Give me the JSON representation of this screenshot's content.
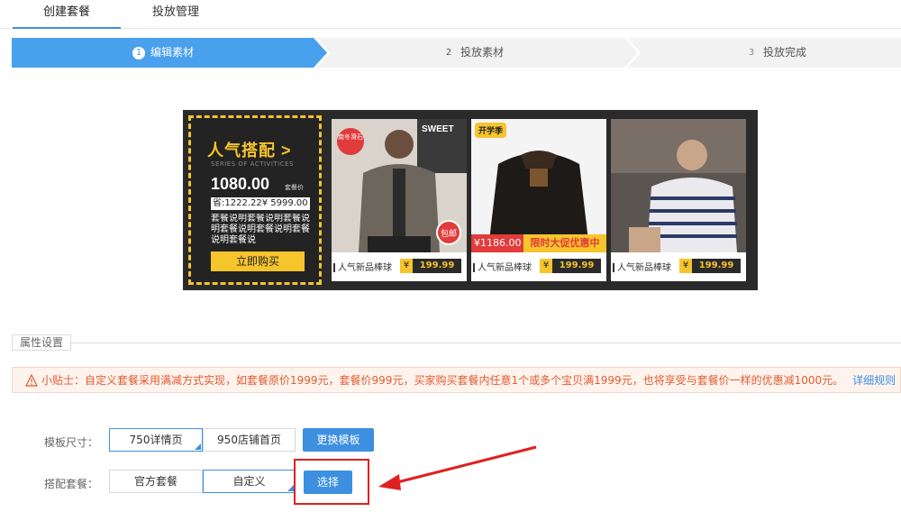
{
  "tabs": [
    {
      "label": "创建套餐",
      "active": true
    },
    {
      "label": "投放管理",
      "active": false
    }
  ],
  "steps": [
    {
      "num": "1",
      "label": "编辑素材",
      "active": true
    },
    {
      "num": "2",
      "label": "投放素材",
      "active": false
    },
    {
      "num": "3",
      "label": "投放完成",
      "active": false
    }
  ],
  "colors": {
    "accent": "#3d8fe0",
    "step_active": "#49a0ec",
    "yellow": "#f6c42b",
    "red": "#e02020"
  },
  "banner": {
    "title": "人气搭配",
    "title_arrow": ">",
    "subtitle": "SERIES OF ACTIVITICES",
    "price": "1080.00",
    "price_unit": "套餐价",
    "orig": "省:1222.22¥ 5999.00",
    "desc": "套餐说明套餐说明套餐说明套餐说明套餐说明套餐说明套餐说",
    "buy_label": "立即购买",
    "products": [
      {
        "caption": "人气新品棒球",
        "yen": "¥",
        "price": "199.99",
        "badge_top": "南冬滑石",
        "badge_bottom": "包邮"
      },
      {
        "caption": "人气新品棒球",
        "yen": "¥",
        "price": "199.99",
        "badge_tag": "开学季",
        "price_tag": "¥1186.00",
        "promo_tag": "限时大促优惠中"
      },
      {
        "caption": "人气新品棒球",
        "yen": "¥",
        "price": "199.99"
      }
    ],
    "shirt_text": "SWEET"
  },
  "section": {
    "title": "属性设置"
  },
  "tip": {
    "text": "小贴士：自定义套餐采用满减方式实现，如套餐原价1999元，套餐价999元，买家购买套餐内任意1个或多个宝贝满1999元，也将享受与套餐价一样的优惠减1000元。",
    "link": "详细规则"
  },
  "form": {
    "template_size": {
      "label": "模板尺寸：",
      "options": [
        "750详情页",
        "950店铺首页"
      ],
      "selected": "750详情页",
      "button": "更换模板"
    },
    "bundle": {
      "label": "搭配套餐：",
      "options": [
        "官方套餐",
        "自定义"
      ],
      "selected": "自定义",
      "button": "选择"
    }
  }
}
